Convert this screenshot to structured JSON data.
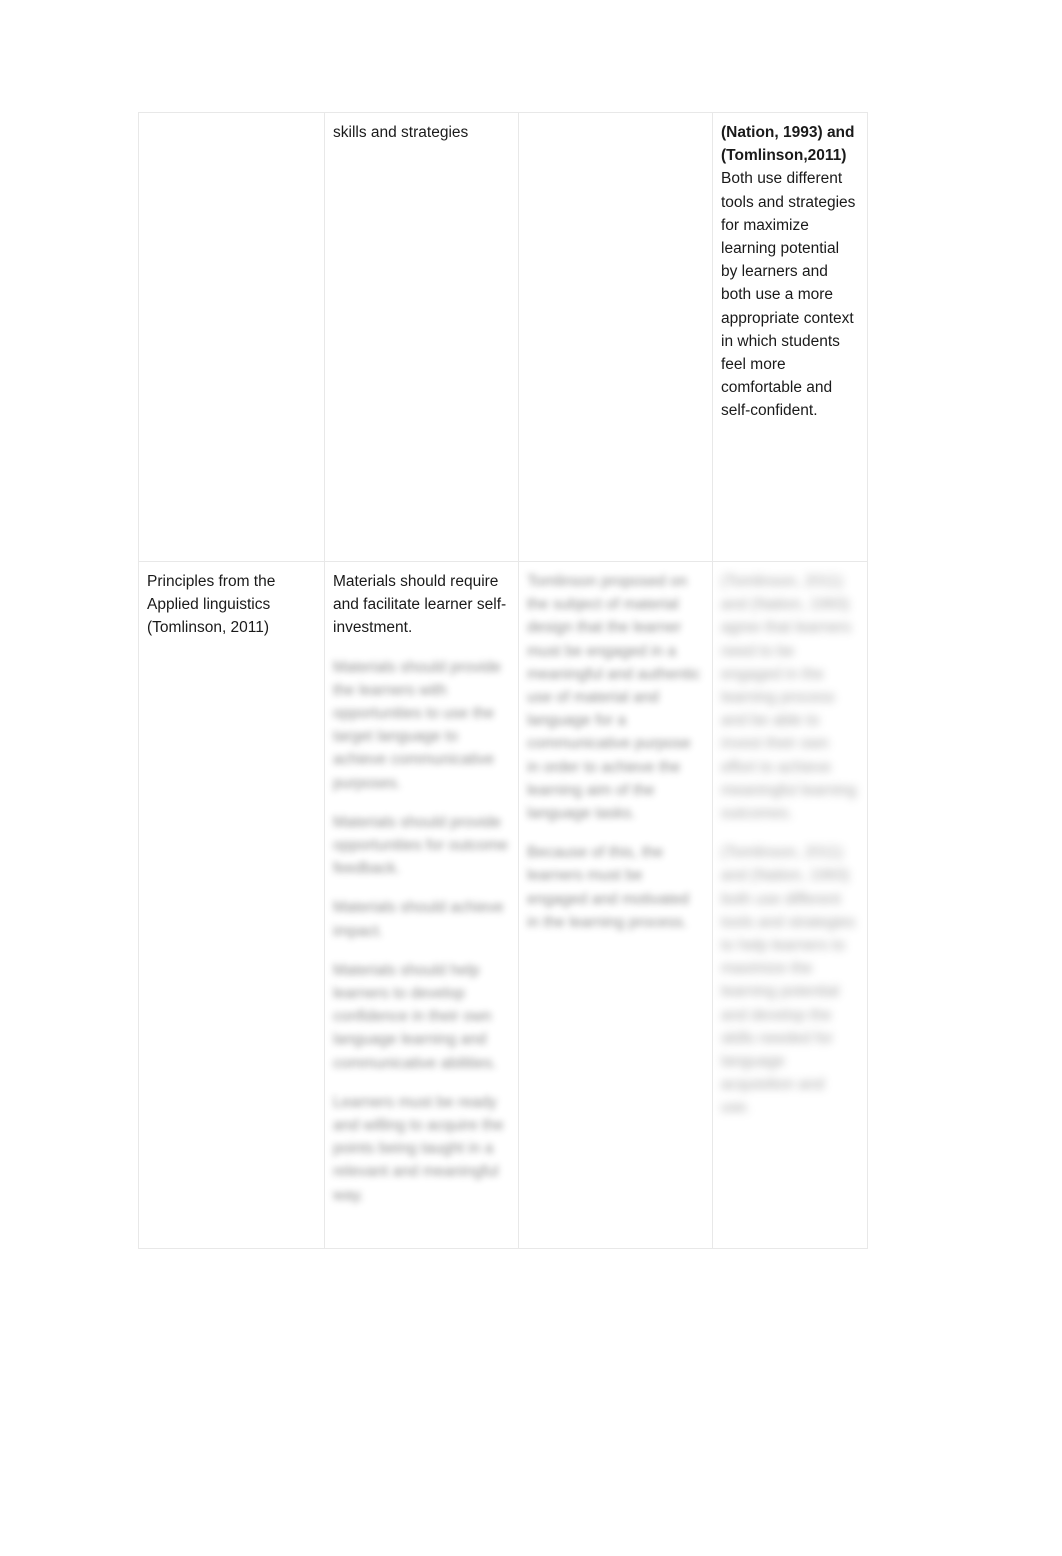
{
  "document": {
    "page_background": "#ffffff",
    "text_color": "#1a1a1a",
    "table_border_color": "#e8e8e8"
  },
  "table": {
    "columns": 4,
    "rows": [
      {
        "row_index": 1,
        "cells": [
          {
            "col": 1,
            "text": "",
            "blurred": false
          },
          {
            "col": 2,
            "text": "skills and strategies",
            "blurred": false
          },
          {
            "col": 3,
            "text": "",
            "blurred": false
          },
          {
            "col": 4,
            "blurred": false,
            "heading": "(Nation, 1993) and (Tomlinson,2011)",
            "text": "Both use different tools and strategies for maximize learning potential by learners and both use a more appropriate context in which students feel more comfortable and self-confident."
          }
        ]
      },
      {
        "row_index": 2,
        "cells": [
          {
            "col": 1,
            "blurred": false,
            "text": "Principles from the Applied linguistics (Tomlinson, 2011)"
          },
          {
            "col": 2,
            "blurred": true,
            "text": "Materials should require and facilitate learner self-investment.",
            "redacted_paragraphs": [
              "Materials should provide the learners with opportunities to use the target language to achieve communicative purposes.",
              "Materials should provide opportunities for outcome feedback.",
              "Materials should achieve impact.",
              "Materials should help learners to develop confidence in their own language learning and communicative abilities.",
              "Learners must be ready and willing to acquire the points being taught in a relevant and meaningful way."
            ]
          },
          {
            "col": 3,
            "blurred": true,
            "redacted_paragraphs": [
              "Tomlinson proposed on the subject of material design that the learner must be engaged in a meaningful and authentic use of material and language for a communicative purpose in order to achieve the learning aim of the language tasks.",
              "Because of this, the learners must be engaged and motivated in the learning process."
            ]
          },
          {
            "col": 4,
            "blurred": true,
            "redacted_paragraphs": [
              "(Tomlinson, 2011) and (Nation, 1993) agree that learners need to be engaged in the learning process and be able to invest their own effort to achieve meaningful learning outcomes.",
              "(Tomlinson, 2011) and (Nation, 1993) both use different tools and strategies to help learners to maximize the learning potential and develop the skills needed for language acquisition and use."
            ]
          }
        ]
      }
    ]
  }
}
